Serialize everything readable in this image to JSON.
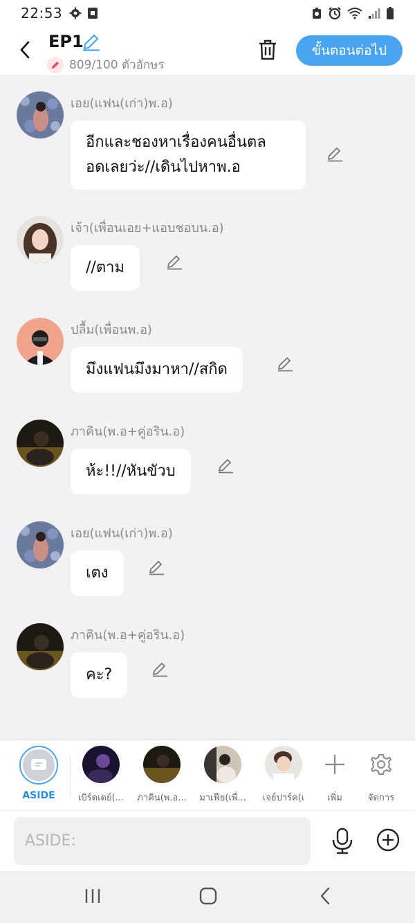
{
  "status": {
    "time": "22:53"
  },
  "header": {
    "title": "EP1",
    "counter": "809/100 ตัวอักษร",
    "next_label": "ขั้นตอนต่อไป"
  },
  "messages": [
    {
      "speaker": "เอย(แฟน(เก่า)พ.อ)",
      "lines": [
        "อีกและชองหาเรื่องคนอื่นตล",
        "อดเลยว่ะ//เดินไปหาพ.อ"
      ]
    },
    {
      "speaker": "เจ้า(เพื่อนเอย+แอบชอบน.อ)",
      "lines": [
        "//ตาม"
      ]
    },
    {
      "speaker": "ปลื้ม(เพื่อนพ.อ)",
      "lines": [
        "มึงแฟนมึงมาหา//สกิด"
      ]
    },
    {
      "speaker": "ภาคิน(พ.อ+คู่อริน.อ)",
      "lines": [
        "ห้ะ!!//หันขัวบ"
      ]
    },
    {
      "speaker": "เอย(แฟน(เก่า)พ.อ)",
      "lines": [
        "เตง"
      ]
    },
    {
      "speaker": "ภาคิน(พ.อ+คู่อริน.อ)",
      "lines": [
        "คะ?"
      ]
    }
  ],
  "cast_bar": {
    "aside_label": "ASIDE",
    "members": [
      "เบิร์ดเดย์(...",
      "ภาคิน(พ.อ...",
      "มาเฟีย(เพื่...",
      "เจย์ปาร์ค(เ"
    ],
    "add_label": "เพิ่ม",
    "manage_label": "จัดการ"
  },
  "input": {
    "placeholder": "ASIDE:"
  },
  "colors": {
    "accent": "#4aa5f0",
    "bubble": "#ffffff",
    "background": "#f2f2f4"
  }
}
